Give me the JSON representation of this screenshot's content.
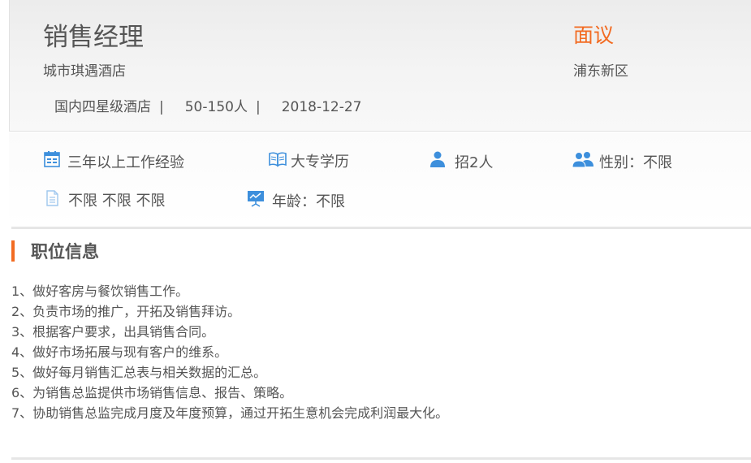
{
  "job": {
    "title": "销售经理",
    "salary": "面议",
    "company": "城市琪遇酒店",
    "location": "浦东新区",
    "company_type": "国内四星级酒店",
    "company_size": "50-150人",
    "post_date": "2018-12-27",
    "separator": "|"
  },
  "requirements": {
    "experience": "三年以上工作经验",
    "education": "大专学历",
    "headcount": "招2人",
    "gender": "性别：不限",
    "other": "不限 不限 不限",
    "age": "年龄：不限"
  },
  "icons": {
    "experience": "calendar-icon",
    "education": "book-icon",
    "headcount": "person-icon",
    "gender": "people-icon",
    "other": "document-icon",
    "age": "presentation-icon"
  },
  "colors": {
    "accent": "#f26b22",
    "icon_blue": "#3d8fdc",
    "text": "#555555"
  },
  "section": {
    "title": "职位信息"
  },
  "duties": [
    "1、做好客房与餐饮销售工作。",
    "2、负责市场的推广，开拓及销售拜访。",
    "3、根据客户要求，出具销售合同。",
    "4、做好市场拓展与现有客户的维系。",
    "5、做好每月销售汇总表与相关数据的汇总。",
    "6、为销售总监提供市场销售信息、报告、策略。",
    "7、协助销售总监完成月度及年度预算，通过开拓生意机会完成利润最大化。"
  ]
}
